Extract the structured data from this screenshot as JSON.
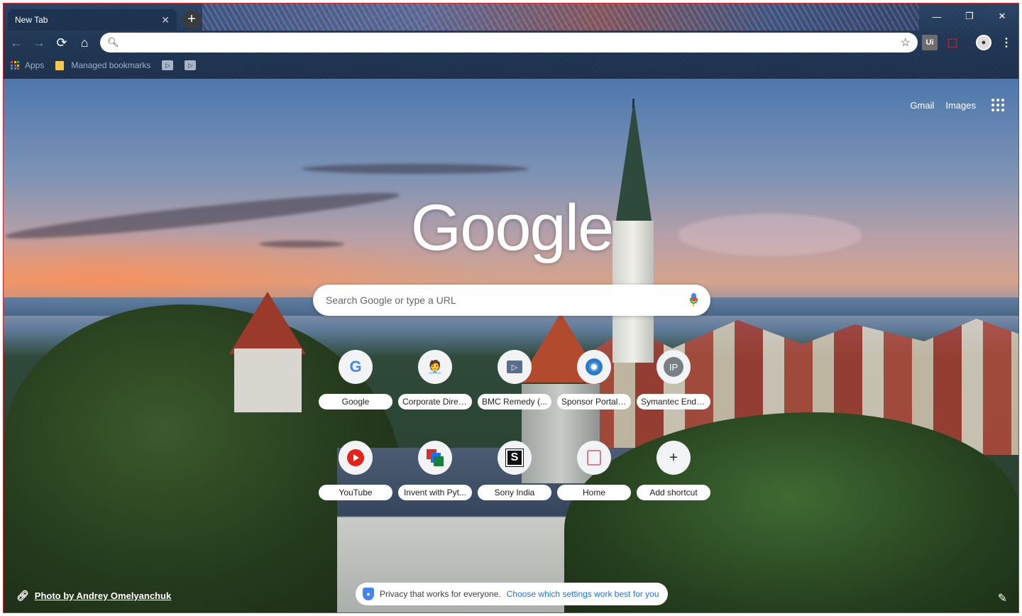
{
  "browser": {
    "tab_title": "New Tab",
    "tab_close": "✕",
    "new_tab": "+",
    "window": {
      "minimize": "—",
      "restore": "❐",
      "close": "✕"
    },
    "nav": {
      "back": "←",
      "forward": "→",
      "reload": "⟳",
      "home": "⌂"
    },
    "omnibox": {
      "value": "",
      "placeholder": ""
    },
    "extensions": {
      "ui_label": "Ui",
      "menu": "⋮"
    },
    "bookmarks": {
      "apps_label": "Apps",
      "managed_label": "Managed bookmarks"
    }
  },
  "ntp": {
    "top_links": {
      "gmail": "Gmail",
      "images": "Images"
    },
    "logo": "Google",
    "search_placeholder": "Search Google or type a URL",
    "shortcuts_row1": [
      {
        "label": "Google"
      },
      {
        "label": "Corporate Direc..."
      },
      {
        "label": "BMC Remedy (..."
      },
      {
        "label": "Sponsor Portal ..."
      },
      {
        "label": "Symantec Endp..."
      }
    ],
    "shortcuts_row2": [
      {
        "label": "YouTube"
      },
      {
        "label": "Invent with Pyt..."
      },
      {
        "label": "Sony India"
      },
      {
        "label": "Home"
      },
      {
        "label": "Add shortcut"
      }
    ],
    "tile_glyphs": {
      "google": "G",
      "ip": "IP",
      "sony": "S",
      "bmc": "▷",
      "add": "+"
    },
    "attribution": "Photo by Andrey Omelyanchuk",
    "privacy": {
      "text": "Privacy that works for everyone.",
      "link": "Choose which settings work best for you"
    }
  },
  "colors": {
    "accent_blue": "#1a73e8",
    "frame_border": "#e02020",
    "youtube_red": "#e62117"
  }
}
